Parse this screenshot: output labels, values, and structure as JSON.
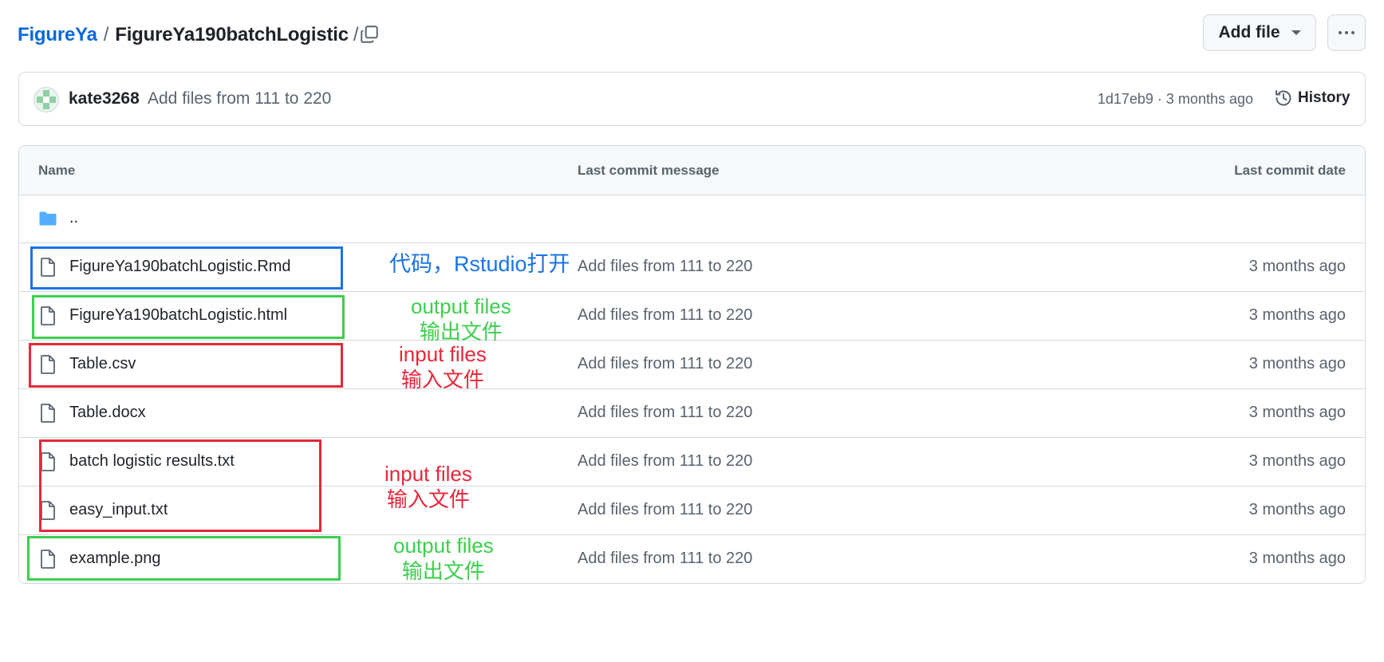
{
  "breadcrumb": {
    "repo": "FigureYa",
    "separator": "/",
    "folder": "FigureYa190batchLogistic",
    "trailing": "/"
  },
  "toolbar": {
    "add_file_label": "Add file"
  },
  "latest_commit": {
    "author": "kate3268",
    "message": "Add files from 111 to 220",
    "sha": "1d17eb9",
    "dot": "·",
    "time": "3 months ago",
    "history_label": "History"
  },
  "table": {
    "headers": {
      "name": "Name",
      "message": "Last commit message",
      "date": "Last commit date"
    },
    "parent_dir": "..",
    "files": [
      {
        "name": "FigureYa190batchLogistic.Rmd",
        "message": "Add files from 111 to 220",
        "date": "3 months ago"
      },
      {
        "name": "FigureYa190batchLogistic.html",
        "message": "Add files from 111 to 220",
        "date": "3 months ago"
      },
      {
        "name": "Table.csv",
        "message": "Add files from 111 to 220",
        "date": "3 months ago"
      },
      {
        "name": "Table.docx",
        "message": "Add files from 111 to 220",
        "date": "3 months ago"
      },
      {
        "name": "batch logistic results.txt",
        "message": "Add files from 111 to 220",
        "date": "3 months ago"
      },
      {
        "name": "easy_input.txt",
        "message": "Add files from 111 to 220",
        "date": "3 months ago"
      },
      {
        "name": "example.png",
        "message": "Add files from 111 to 220",
        "date": "3 months ago"
      }
    ]
  },
  "annotations": {
    "code_label": "代码，Rstudio打开",
    "output_1": {
      "line1": "output files",
      "line2": "输出文件"
    },
    "input_1": {
      "line1": "input files",
      "line2": "输入文件"
    },
    "input_2": {
      "line1": "input files",
      "line2": "输入文件"
    },
    "output_2": {
      "line1": "output files",
      "line2": "输出文件"
    }
  },
  "colors": {
    "link_blue": "#0969da",
    "annotation_blue": "#1a73e8",
    "annotation_green": "#3ccf4e",
    "annotation_red": "#e8273a",
    "folder_icon": "#54aeff",
    "muted_text": "#59636e",
    "border": "#d1d9e0"
  }
}
